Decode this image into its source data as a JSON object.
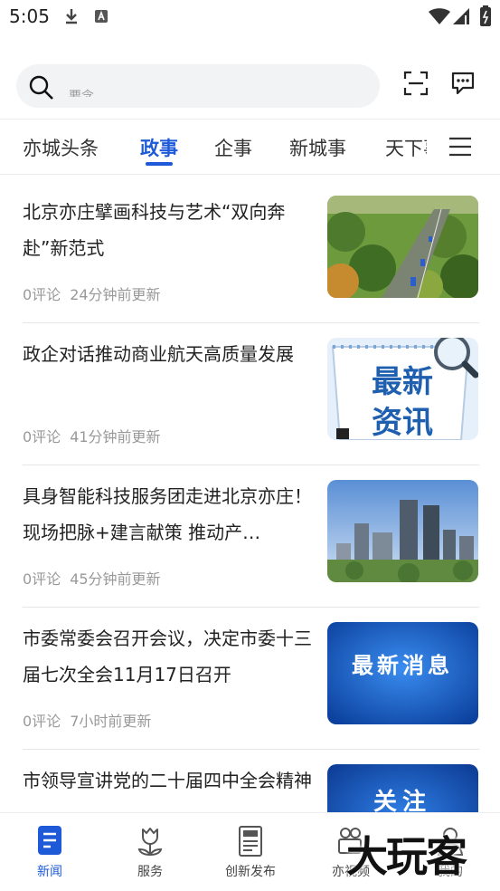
{
  "status_bar": {
    "time": "5:05"
  },
  "search": {
    "placeholder": "要念"
  },
  "tabs": [
    {
      "label": "亦城头条"
    },
    {
      "label": "政事"
    },
    {
      "label": "企事"
    },
    {
      "label": "新城事"
    },
    {
      "label": "天下事"
    }
  ],
  "active_tab": "政事",
  "news": [
    {
      "title": "北京亦庄擘画科技与艺术“双向奔赴”新范式",
      "comments": "0评论",
      "time": "24分钟前更新",
      "thumb": "tree-lined highway aerial"
    },
    {
      "title": "政企对话推动商业航天高质量发展",
      "comments": "0评论",
      "time": "41分钟前更新",
      "thumb_text": "最新\n资讯",
      "thumb_line1": "最新",
      "thumb_line2": "资讯"
    },
    {
      "title": "具身智能科技服务团走进北京亦庄！现场把脉+建言献策  推动产…",
      "comments": "0评论",
      "time": "45分钟前更新",
      "thumb": "city skyline"
    },
    {
      "title": "市委常委会召开会议，决定市委十三届七次全会11月17日召开",
      "comments": "0评论",
      "time": "7小时前更新",
      "thumb_text": "最新消息"
    },
    {
      "title": "市领导宣讲党的二十届四中全会精神",
      "comments": "",
      "time": "",
      "thumb_text": "关注"
    }
  ],
  "tabbar": [
    {
      "label": "新闻",
      "icon": "news-icon"
    },
    {
      "label": "服务",
      "icon": "tulip-icon"
    },
    {
      "label": "创新发布",
      "icon": "newspaper-icon"
    },
    {
      "label": "亦视频",
      "icon": "video-camera-icon"
    },
    {
      "label": "我的",
      "icon": "user-icon"
    }
  ],
  "watermark": "大玩客",
  "colors": {
    "accent": "#1e5ad8",
    "text": "#222222",
    "meta": "#999999"
  }
}
